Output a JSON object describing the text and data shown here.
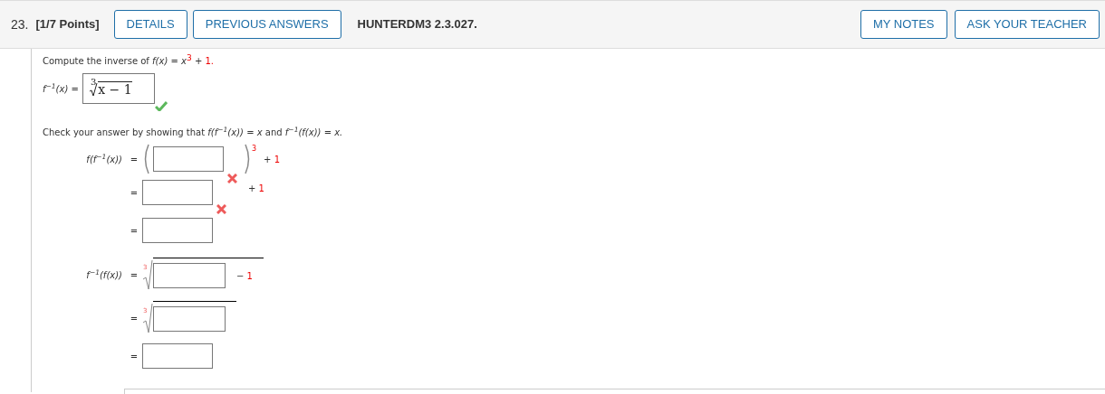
{
  "header": {
    "number": "23.",
    "points": "[1/7 Points]",
    "buttons": [
      "DETAILS",
      "PREVIOUS ANSWERS"
    ],
    "code": "HUNTERDM3 2.3.027.",
    "right_buttons": [
      "MY NOTES",
      "ASK YOUR TEACHER"
    ]
  },
  "prompt": {
    "text": "Compute the inverse of",
    "function": "f(x) = x",
    "exponent": "3",
    "op": "+",
    "constant": "1."
  },
  "answer": {
    "label": "f$^{−1}$(x) =",
    "index": "3",
    "radicand": "x − 1",
    "correct": true
  },
  "check": {
    "text": "Check your answer by showing that",
    "first": "f(f$^{−1}$(x)) = x",
    "joiner": "and",
    "second": "f$^{−1}$(f(x)) = x."
  },
  "steps": [
    {
      "kind": "power",
      "lhs": "f(f$^{−1}$(x))",
      "relation": "=",
      "exponent": "3",
      "wrong": true,
      "op": "+",
      "constant": "1"
    },
    {
      "kind": "box",
      "relation": "=",
      "wrong": true,
      "op": "+",
      "constant": "1"
    },
    {
      "kind": "box",
      "relation": "=",
      "wrong": false
    },
    {
      "kind": "root",
      "lhs": "f$^{−1}$(f(x))",
      "relation": "=",
      "index": "3",
      "wrong": false,
      "op": "−",
      "constant": "1"
    },
    {
      "kind": "root",
      "relation": "=",
      "index": "3",
      "wrong": false
    },
    {
      "kind": "box",
      "relation": "=",
      "wrong": false
    }
  ]
}
